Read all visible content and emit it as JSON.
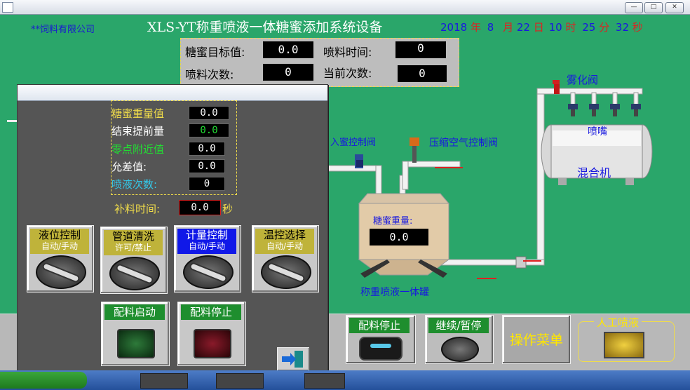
{
  "header": {
    "company": "**饲料有限公司",
    "title": "XLS-YT称重喷液一体糖蜜添加系统设备",
    "datetime": {
      "year": "2018",
      "year_unit": "年",
      "month": "8",
      "month_unit": "月",
      "day": "22",
      "day_unit": "日",
      "hour": "10",
      "hour_unit": "时",
      "minute": "25",
      "minute_unit": "分",
      "second": "32",
      "second_unit": "秒"
    }
  },
  "top_params": {
    "target_label": "糖蜜目标值:",
    "target_value": "0.0",
    "spray_time_label": "喷料时间:",
    "spray_time_value": "0",
    "spray_count_label": "喷料次数:",
    "spray_count_value": "0",
    "current_count_label": "当前次数:",
    "current_count_value": "0"
  },
  "popup": {
    "params": [
      {
        "label": "糖蜜重量值",
        "value": "0.0",
        "color": "#f0dc4a"
      },
      {
        "label": "结束提前量",
        "value": "0.0",
        "color": "#ffffff"
      },
      {
        "label": "零点附近值",
        "value": "0.0",
        "color": "#22dd33"
      },
      {
        "label": "允差值:",
        "value": "0.0",
        "color": "#ffffff"
      },
      {
        "label": "喷液次数:",
        "value": "0",
        "color": "#33c8e8"
      }
    ],
    "fill_time_label": "补料时间:",
    "fill_time_value": "0.0",
    "fill_time_unit": "秒",
    "switches": [
      {
        "title": "液位控制",
        "sub": "自动/手动",
        "bg": "#bfb33a"
      },
      {
        "title": "管道清洗",
        "sub": "许可/禁止",
        "bg": "#bfb33a"
      },
      {
        "title": "计量控制",
        "sub": "自动/手动",
        "bg": "#1018e8"
      },
      {
        "title": "温控选择",
        "sub": "自动/手动",
        "bg": "#bfb33a"
      }
    ],
    "start_label": "配料启动",
    "stop_label": "配料停止"
  },
  "diagram": {
    "atomizing_valve": "雾化阀",
    "nozzle": "喷嘴",
    "mixer": "混合机",
    "inlet_valve": "入蜜控制阀",
    "air_valve": "压缩空气控制阀",
    "tank_weight_label": "糖蜜重量:",
    "tank_weight_value": "0.0",
    "tank_name": "称重喷液一体罐"
  },
  "bottom": {
    "batch_stop": "配料停止",
    "continue_pause": "继续/暂停",
    "operation_menu": "操作菜单",
    "manual_spray": "人工喷液"
  },
  "colors": {
    "background": "#2aa66a",
    "title": "#ffffff",
    "time_number": "#1818e0",
    "time_unit": "#e02020"
  }
}
